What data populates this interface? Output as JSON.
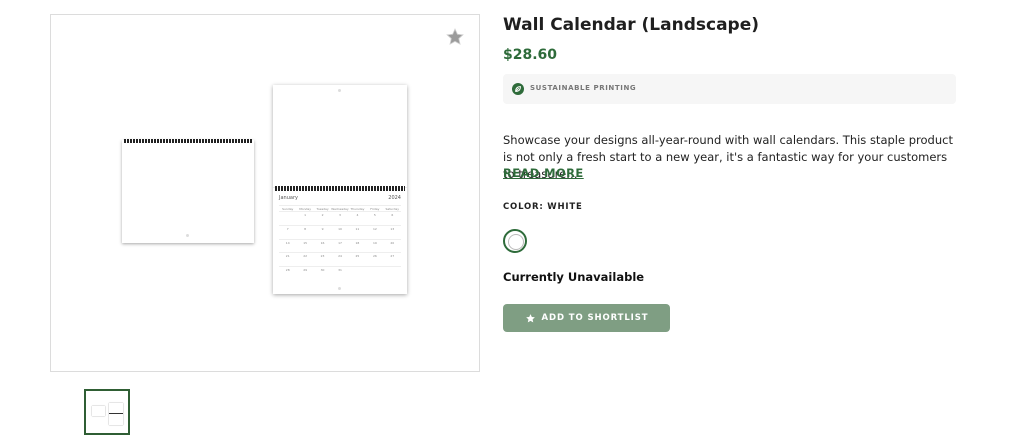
{
  "product": {
    "title": "Wall Calendar (Landscape)",
    "price": "$28.60",
    "badge": {
      "icon": "leaf-icon",
      "text": "SUSTAINABLE PRINTING"
    },
    "description": "Showcase your designs all-year-round with wall calendars. This staple product is not only a fresh start to a new year, it's a fantastic way for your customers to treasure…",
    "read_more": "READ MORE",
    "color_label": "COLOR: WHITE",
    "availability": "Currently Unavailable",
    "shortlist_button": "ADD TO SHORTLIST"
  },
  "preview": {
    "month": "January",
    "year": "2024",
    "weekdays": [
      "Sunday",
      "Monday",
      "Tuesday",
      "Wednesday",
      "Thursday",
      "Friday",
      "Saturday"
    ],
    "days": [
      "",
      "1",
      "2",
      "3",
      "4",
      "5",
      "6",
      "7",
      "8",
      "9",
      "10",
      "11",
      "12",
      "13",
      "14",
      "15",
      "16",
      "17",
      "18",
      "19",
      "20",
      "21",
      "22",
      "23",
      "24",
      "25",
      "26",
      "27",
      "28",
      "29",
      "30",
      "31",
      "",
      "",
      ""
    ]
  },
  "colors": {
    "accent": "#2e6b3a",
    "button": "#7f9e83",
    "badge_bg": "#f6f6f6"
  }
}
